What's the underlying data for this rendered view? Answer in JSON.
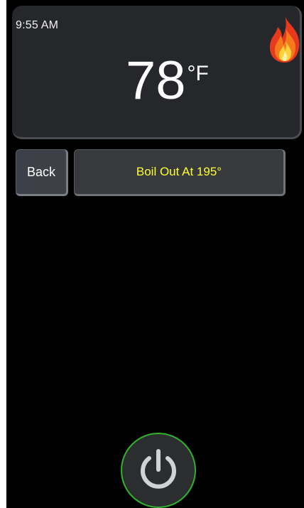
{
  "status": {
    "time": "9:55 AM",
    "temperature": "78",
    "unit": "°F",
    "flame_icon": "flame-icon"
  },
  "controls": {
    "back_label": "Back",
    "mode_label": "Boil Out At 195°"
  },
  "power": {
    "icon": "power-icon",
    "ring_color": "#2fb32f"
  },
  "colors": {
    "mode_text": "#ffff2e",
    "card_bg": "#25272b",
    "screen_bg": "#000000"
  }
}
